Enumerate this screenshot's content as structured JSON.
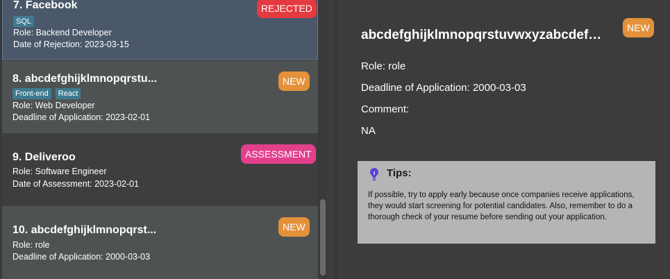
{
  "list": {
    "items": [
      {
        "index": "7.",
        "company": "Facebook",
        "tags": [
          "SQL"
        ],
        "role": "Role: Backend Developer",
        "date": "Date of Rejection: 2023-03-15",
        "status": "REJECTED"
      },
      {
        "index": "8.",
        "company": "abcdefghijklmnopqrstu...",
        "tags": [
          "Front-end",
          "React"
        ],
        "role": "Role: Web Developer",
        "date": "Deadline of Application: 2023-02-01",
        "status": "NEW"
      },
      {
        "index": "9.",
        "company": "Deliveroo",
        "tags": [],
        "role": "Role: Software Engineer",
        "date": "Date of Assessment: 2023-02-01",
        "status": "ASSESSMENT"
      },
      {
        "index": "10.",
        "company": "abcdefghijklmnopqrst...",
        "tags": [],
        "role": "Role: role",
        "date": "Deadline of Application: 2000-03-03",
        "status": "NEW"
      }
    ]
  },
  "detail": {
    "title": "abcdefghijklmnopqrstuvwxyzabcdefghijk...",
    "status": "NEW",
    "role": "Role: role",
    "deadline": "Deadline of Application: 2000-03-03",
    "comment_label": "Comment:",
    "comment_value": "NA"
  },
  "tips": {
    "icon": "lightbulb-icon",
    "title": "Tips:",
    "body": "If possible, try to apply early because once companies receive applications, they would start screening for potential candidates. Also, remember to do a thorough check of your resume before sending out your application."
  },
  "colors": {
    "new": "#e4913b",
    "rejected": "#e43a40",
    "assessment": "#e23f8c",
    "tag": "#3e7b91"
  }
}
